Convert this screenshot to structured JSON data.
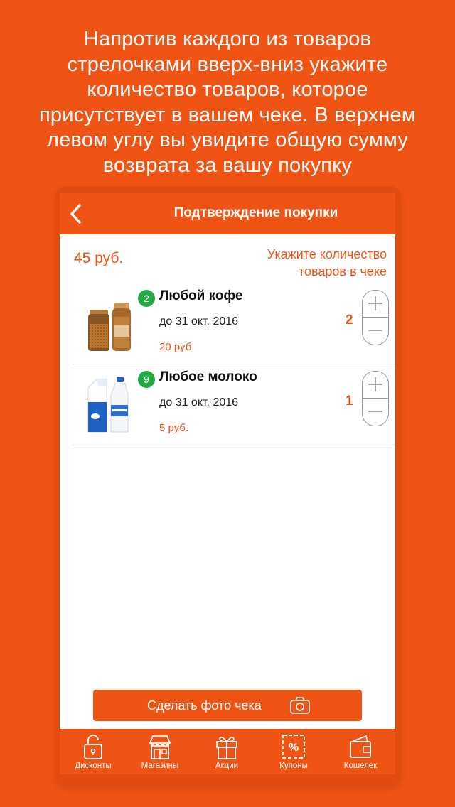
{
  "promo_text_lines": [
    "Напротив каждого из товаров",
    "стрелочками вверх-вниз укажите",
    "количество товаров, которое",
    "присутствует в вашем чеке. В верхнем",
    "левом углу вы увидите общую сумму",
    "возврата за вашу покупку"
  ],
  "navbar": {
    "title": "Подтверждение покупки",
    "back_icon": "chevron-left-icon"
  },
  "summary": {
    "total": "45  руб.",
    "hint_line1": "Укажите количество",
    "hint_line2": "товаров в чеке"
  },
  "products": [
    {
      "badge": "2",
      "name": "Любой кофе",
      "date": "до 31 окт. 2016",
      "price": "20  руб.",
      "quantity": "2",
      "image": "coffee-jars-image"
    },
    {
      "badge": "9",
      "name": "Любое молоко",
      "date": "до 31 окт. 2016",
      "price": "5  руб.",
      "quantity": "1",
      "image": "milk-carton-bottle-image"
    }
  ],
  "photo_button": {
    "label": "Сделать фото чека",
    "icon": "camera-icon"
  },
  "tabs": [
    {
      "label": "Дисконты",
      "icon": "lock-icon"
    },
    {
      "label": "Магазины",
      "icon": "store-icon"
    },
    {
      "label": "Акции",
      "icon": "gift-icon"
    },
    {
      "label": "Купоны",
      "icon": "coupon-icon"
    },
    {
      "label": "Кошелек",
      "icon": "wallet-icon"
    }
  ],
  "colors": {
    "brand_orange": "#f05415",
    "badge_green": "#22a845",
    "text_dark": "#111111"
  }
}
